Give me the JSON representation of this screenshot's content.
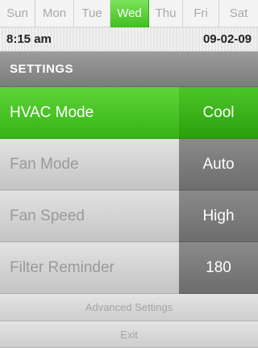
{
  "days": {
    "items": [
      {
        "label": "Sun",
        "active": false
      },
      {
        "label": "Mon",
        "active": false
      },
      {
        "label": "Tue",
        "active": false
      },
      {
        "label": "Wed",
        "active": true
      },
      {
        "label": "Thu",
        "active": false
      },
      {
        "label": "Fri",
        "active": false
      },
      {
        "label": "Sat",
        "active": false
      }
    ]
  },
  "status": {
    "time": "8:15 am",
    "date": "09-02-09"
  },
  "header": {
    "title": "SETTINGS"
  },
  "settings": [
    {
      "label": "HVAC Mode",
      "value": "Cool",
      "selected": true
    },
    {
      "label": "Fan Mode",
      "value": "Auto",
      "selected": false
    },
    {
      "label": "Fan Speed",
      "value": "High",
      "selected": false
    },
    {
      "label": "Filter Reminder",
      "value": "180",
      "selected": false
    }
  ],
  "buttons": {
    "advanced": "Advanced Settings",
    "exit": "Exit"
  },
  "colors": {
    "accent": "#3fbf1d",
    "header": "#8a8a8a",
    "value_bg": "#7a7a7a"
  }
}
